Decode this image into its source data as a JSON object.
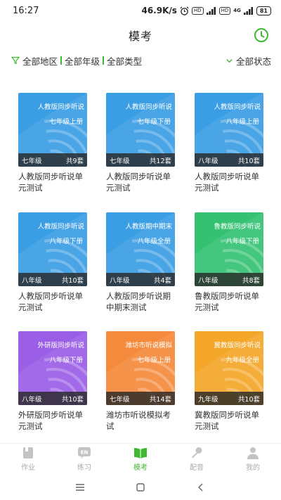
{
  "status": {
    "time": "16:27",
    "speed": "46.9K/s",
    "hd": "HD",
    "signal": "4G",
    "battery": "81"
  },
  "header": {
    "title": "模考"
  },
  "filters": {
    "region": "全部地区",
    "grade": "全部年级",
    "type": "全部类型",
    "status": "全部状态"
  },
  "colors": {
    "accent": "#41b832",
    "blue": "#3a9ee4",
    "green": "#34c272",
    "purple": "#9b5ee6",
    "orange": "#f58a3c",
    "amber": "#f3a628"
  },
  "cards": [
    {
      "line1": "人教版同步听说",
      "line2": "七年级上册",
      "grade": "七年级",
      "count": "共9套",
      "name": "人教版同步听说单元测试",
      "color": "blue"
    },
    {
      "line1": "人教版同步听说",
      "line2": "七年级下册",
      "grade": "七年级",
      "count": "共12套",
      "name": "人教版同步听说单元测试",
      "color": "blue"
    },
    {
      "line1": "人教版同步听说",
      "line2": "八年级上册",
      "grade": "八年级",
      "count": "共10套",
      "name": "人教版同步听说单元测试",
      "color": "blue"
    },
    {
      "line1": "人教版同步听说",
      "line2": "八年级下册",
      "grade": "八年级",
      "count": "共10套",
      "name": "人教版同步听说单元测试",
      "color": "blue"
    },
    {
      "line1": "人教版期中期末",
      "line2": "八年级全册",
      "grade": "八年级",
      "count": "共4套",
      "name": "人教版同步听说期中期末测试",
      "color": "blue"
    },
    {
      "line1": "鲁教版同步听说",
      "line2": "八年级下册",
      "grade": "八年级",
      "count": "共8套",
      "name": "鲁教版同步听说单元测试",
      "color": "green"
    },
    {
      "line1": "外研版同步听说",
      "line2": "八年级下册",
      "grade": "八年级",
      "count": "共10套",
      "name": "外研版同步听说单元测试",
      "color": "purple"
    },
    {
      "line1": "潍坊市听说模拟",
      "line2": "七年级上册",
      "grade": "七年级",
      "count": "共14套",
      "name": "潍坊市听说模拟考试",
      "color": "orange"
    },
    {
      "line1": "冀教版同步听说",
      "line2": "九年级全册",
      "grade": "九年级",
      "count": "共10套",
      "name": "冀教版同步听说单元测试",
      "color": "amber"
    }
  ],
  "tabs": [
    {
      "label": "作业",
      "icon": "homework-icon"
    },
    {
      "label": "练习",
      "icon": "en-practice-icon",
      "badge": "EN"
    },
    {
      "label": "模考",
      "icon": "book-icon"
    },
    {
      "label": "配音",
      "icon": "microphone-icon"
    },
    {
      "label": "我的",
      "icon": "person-icon"
    }
  ]
}
